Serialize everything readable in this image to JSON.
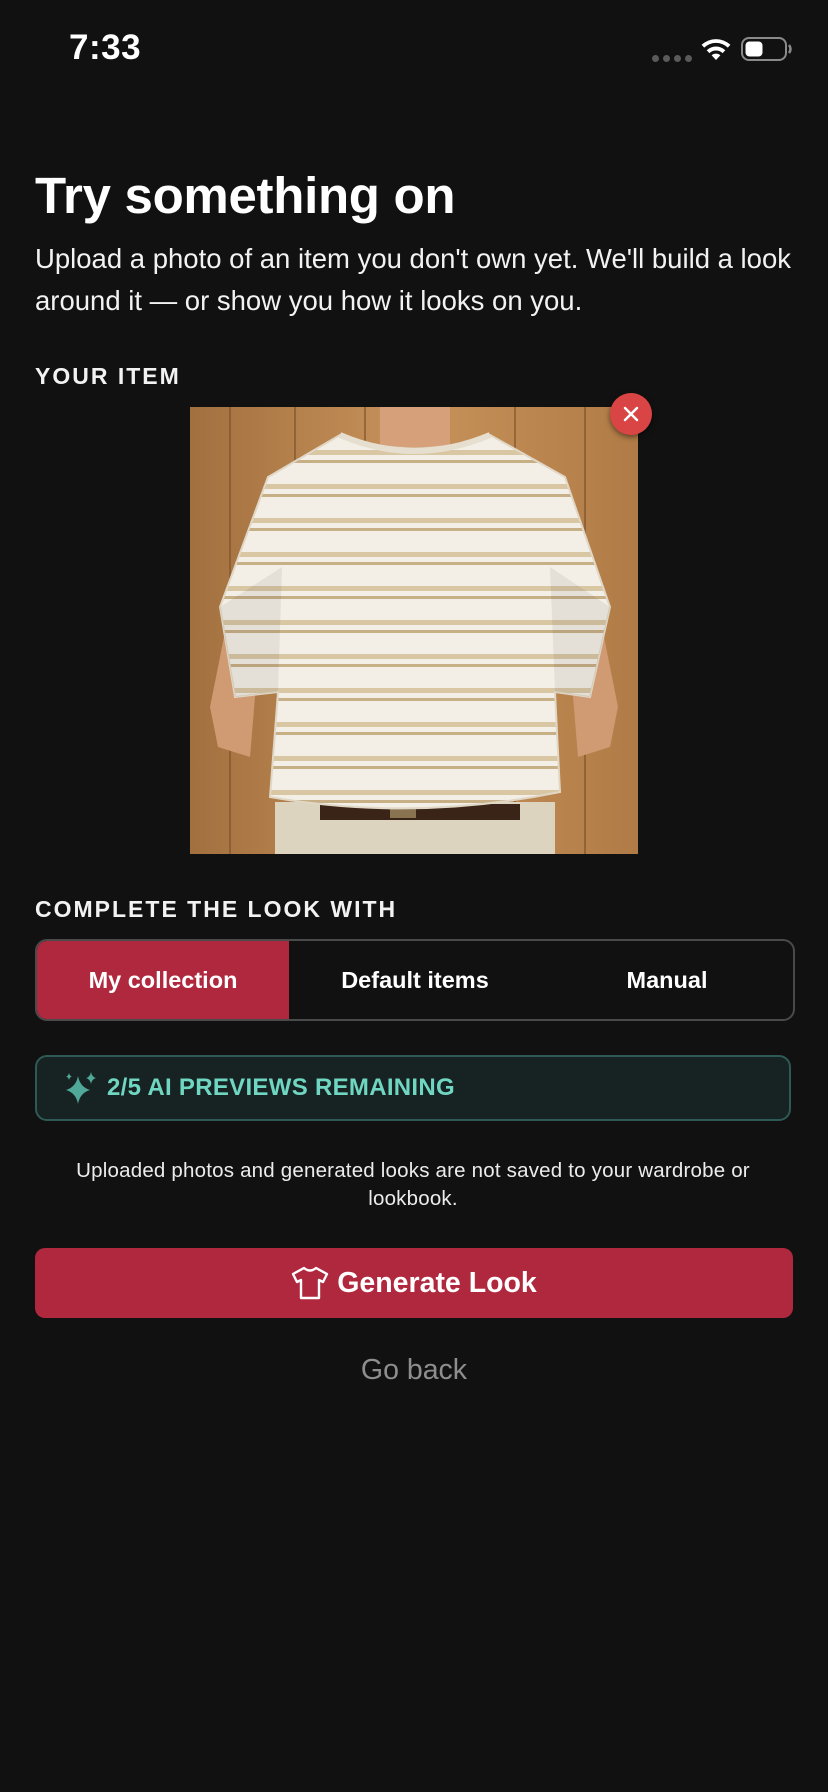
{
  "status_bar": {
    "time": "7:33",
    "icons": [
      "cellular-signal-icon",
      "wifi-icon",
      "battery-icon"
    ]
  },
  "header": {
    "title": "Try something on",
    "subtitle": "Upload a photo of an item you don't own yet. We'll build a look around it — or show you how it looks on you."
  },
  "item_section": {
    "label": "YOUR ITEM",
    "image_description_icon": "striped-tshirt-photo",
    "remove_icon": "close-icon"
  },
  "complete_section": {
    "label": "COMPLETE THE LOOK WITH",
    "options": [
      {
        "label": "My collection",
        "selected": true
      },
      {
        "label": "Default items",
        "selected": false
      },
      {
        "label": "Manual",
        "selected": false
      }
    ]
  },
  "ai_banner": {
    "icon": "sparkle-icon",
    "text": "2/5 AI PREVIEWS REMAINING"
  },
  "disclaimer": "Uploaded photos and generated looks are not saved to your wardrobe or lookbook.",
  "actions": {
    "generate_icon": "tshirt-icon",
    "generate_label": "Generate Look",
    "go_back_label": "Go back"
  },
  "colors": {
    "background": "#111111",
    "accent": "#b0283e",
    "remove": "#d94444",
    "ai_text": "#6fd6c2",
    "ai_border": "#2e5a55",
    "muted": "#8e8e8e"
  }
}
